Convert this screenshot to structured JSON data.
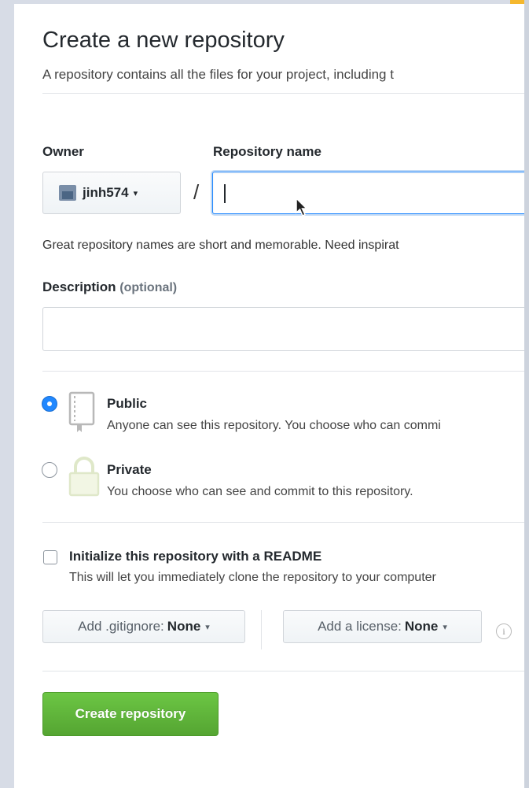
{
  "header": {
    "title": "Create a new repository",
    "subtitle": "A repository contains all the files for your project, including t"
  },
  "owner": {
    "label": "Owner",
    "value": "jinh574",
    "caret": "▾"
  },
  "repo_name": {
    "label": "Repository name",
    "value": "",
    "separator": "/",
    "hint": "Great repository names are short and memorable. Need inspirat"
  },
  "description": {
    "label": "Description",
    "optional": "(optional)",
    "value": ""
  },
  "visibility": {
    "public": {
      "title": "Public",
      "desc": "Anyone can see this repository. You choose who can commi",
      "checked": true
    },
    "private": {
      "title": "Private",
      "desc": "You choose who can see and commit to this repository.",
      "checked": false
    }
  },
  "readme": {
    "label": "Initialize this repository with a README",
    "desc": "This will let you immediately clone the repository to your computer",
    "checked": false
  },
  "gitignore": {
    "label": "Add .gitignore:",
    "value": "None",
    "caret": "▾"
  },
  "license": {
    "label": "Add a license:",
    "value": "None",
    "caret": "▾"
  },
  "info_icon": {
    "glyph": "i"
  },
  "submit": {
    "label": "Create repository"
  },
  "colors": {
    "accent": "#2188ff",
    "button_green": "#6cc644",
    "background": "#d7dce6",
    "corner": "#f5b82e"
  },
  "icons": [
    "repo-book-icon",
    "lock-icon",
    "info-icon",
    "mouse-pointer-icon"
  ]
}
